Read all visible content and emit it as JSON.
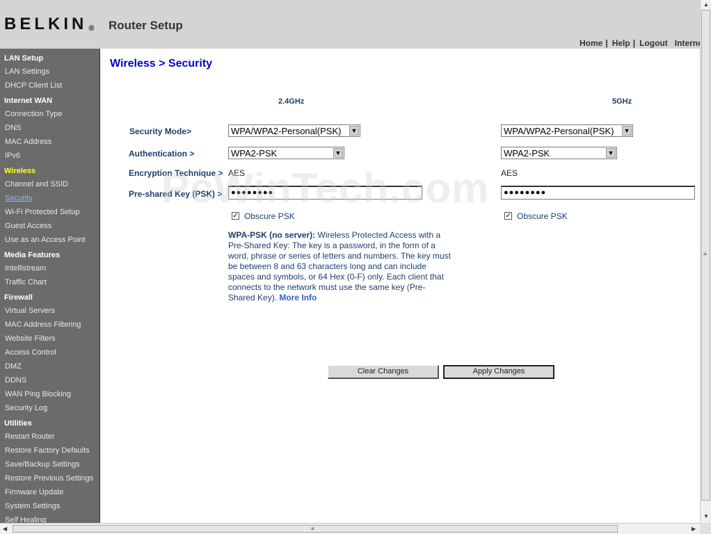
{
  "header": {
    "logo": "BELKIN",
    "logo_mark": "®",
    "title": "Router Setup",
    "nav": {
      "home": "Home",
      "help": "Help",
      "logout": "Logout",
      "internet": "Internet",
      "sep": "|"
    }
  },
  "sidebar": {
    "lan_setup": "LAN Setup",
    "lan_settings": "LAN Settings",
    "dhcp_client_list": "DHCP Client List",
    "internet_wan": "Internet WAN",
    "connection_type": "Connection Type",
    "dns": "DNS",
    "mac_address": "MAC Address",
    "ipv6": "IPv6",
    "wireless": "Wireless",
    "channel_ssid": "Channel and SSID",
    "security": "Security",
    "wifi_protected_setup": "Wi-Fi Protected Setup",
    "guest_access": "Guest Access",
    "access_point": "Use as an Access Point",
    "media_features": "Media Features",
    "intellistream": "Intellistream",
    "traffic_chart": "Traffic Chart",
    "firewall": "Firewall",
    "virtual_servers": "Virtual Servers",
    "mac_filtering": "MAC Address Filtering",
    "website_filters": "Website Filters",
    "access_control": "Access Control",
    "dmz": "DMZ",
    "ddns": "DDNS",
    "wan_ping_blocking": "WAN Ping Blocking",
    "security_log": "Security Log",
    "utilities": "Utilities",
    "restart_router": "Restart Router",
    "restore_factory": "Restore Factory Defaults",
    "save_backup": "Save/Backup Settings",
    "restore_previous": "Restore Previous Settings",
    "firmware_update": "Firmware Update",
    "system_settings": "System Settings",
    "self_healing": "Self Healing"
  },
  "main": {
    "title": "Wireless > Security",
    "band_24": "2.4GHz",
    "band_5": "5GHz",
    "labels": {
      "security_mode": "Security Mode>",
      "authentication": "Authentication >",
      "encryption": "Encryption Technique >",
      "psk": "Pre-shared Key (PSK) >"
    },
    "band24": {
      "security_mode": "WPA/WPA2-Personal(PSK)",
      "authentication": "WPA2-PSK",
      "encryption": "AES",
      "psk_masked": "●●●●●●●●",
      "obscure_label": "Obscure PSK",
      "obscure_checked": "✓"
    },
    "band5": {
      "security_mode": "WPA/WPA2-Personal(PSK)",
      "authentication": "WPA2-PSK",
      "encryption": "AES",
      "psk_masked": "●●●●●●●●",
      "obscure_label": "Obscure PSK",
      "obscure_checked": "✓"
    },
    "desc": {
      "heading": "WPA-PSK (no server):",
      "body": " Wireless Protected Access with a Pre-Shared Key: The key is a password, in the form of a word, phrase or series of letters and numbers. The key must be between 8 and 63 characters long and can include spaces and symbols, or 64 Hex (0-F) only. Each client that connects to the network must use the same key (Pre-Shared Key). ",
      "more_info": "More Info"
    },
    "buttons": {
      "clear": "Clear Changes",
      "apply": "Apply Changes"
    }
  },
  "watermark": "PcWinTech.com",
  "scrollbar": {
    "up": "▲",
    "down": "▼",
    "left": "◀",
    "right": "▶",
    "grip": "≡"
  }
}
